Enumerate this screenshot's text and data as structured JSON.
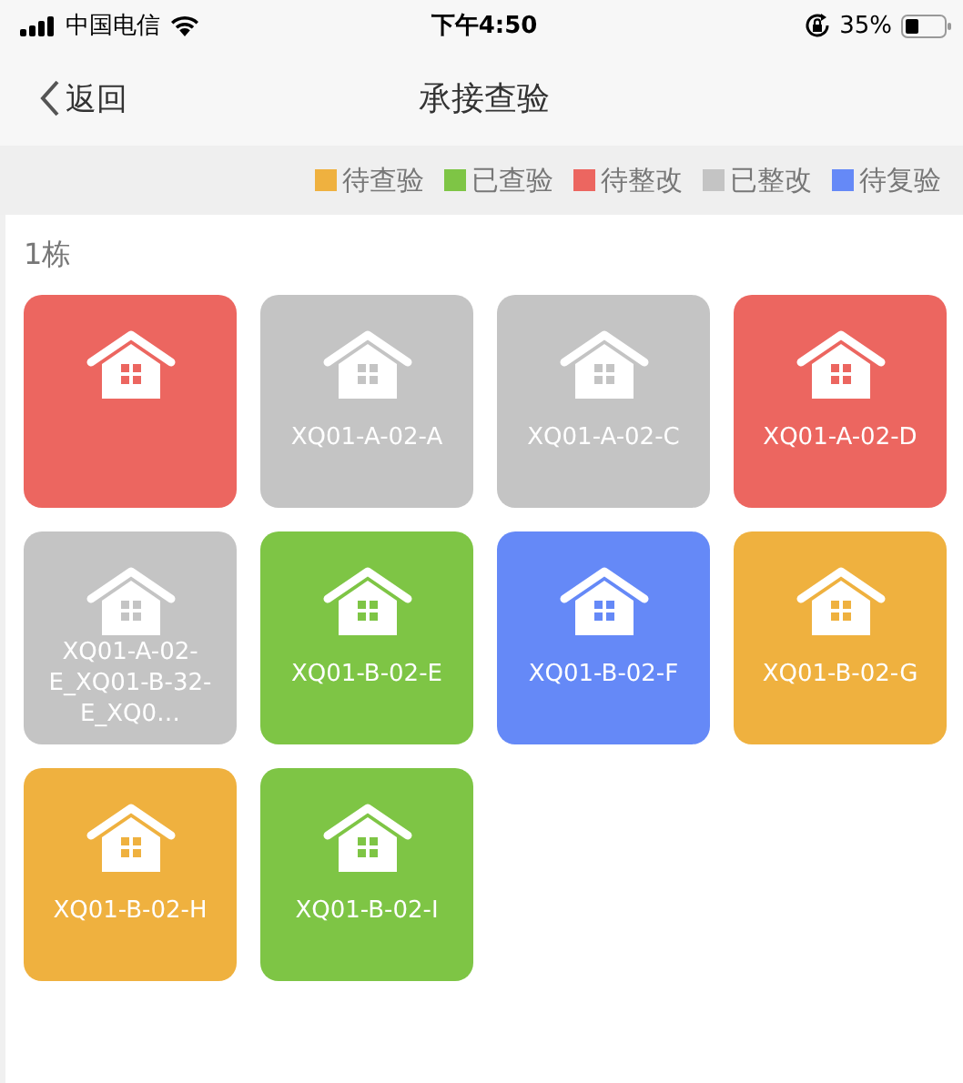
{
  "status_bar": {
    "carrier": "中国电信",
    "time": "下午4:50",
    "battery": "35%"
  },
  "nav": {
    "back": "返回",
    "title": "承接查验"
  },
  "legend": [
    {
      "label": "待查验",
      "color": "#efb13f"
    },
    {
      "label": "已查验",
      "color": "#7ec545"
    },
    {
      "label": "待整改",
      "color": "#ec6660"
    },
    {
      "label": "已整改",
      "color": "#c4c4c4"
    },
    {
      "label": "待复验",
      "color": "#6589f7"
    }
  ],
  "section": {
    "title": "1栋",
    "rooms": [
      {
        "color": "#ec6660"
      },
      {
        "label": "XQ01-A-02-A",
        "color": "#c4c4c4"
      },
      {
        "label": "XQ01-A-02-C",
        "color": "#c4c4c4"
      },
      {
        "label": "XQ01-A-02-D",
        "color": "#ec6660"
      },
      {
        "label": "XQ01-A-02-E_XQ01-B-32-E_XQ0…",
        "color": "#c4c4c4"
      },
      {
        "label": "XQ01-B-02-E",
        "color": "#7ec545"
      },
      {
        "label": "XQ01-B-02-F",
        "color": "#6589f7"
      },
      {
        "label": "XQ01-B-02-G",
        "color": "#efb13f"
      },
      {
        "label": "XQ01-B-02-H",
        "color": "#efb13f"
      },
      {
        "label": "XQ01-B-02-I",
        "color": "#7ec545"
      }
    ]
  }
}
